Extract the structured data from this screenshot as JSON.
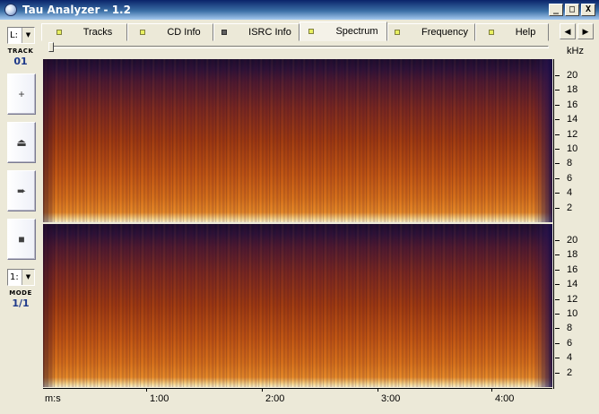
{
  "window": {
    "title": "Tau Analyzer - 1.2",
    "controls": {
      "minimize": "_",
      "maximize": "□",
      "close": "X"
    }
  },
  "sidebar": {
    "channel_combo": "L:",
    "track_label": "TRACK",
    "track_value": "01",
    "buttons": [
      {
        "name": "add",
        "glyph": "+"
      },
      {
        "name": "eject",
        "glyph": "⏏"
      },
      {
        "name": "play",
        "glyph": "➨"
      },
      {
        "name": "stop",
        "glyph": "■"
      }
    ],
    "mode_combo": "1:",
    "mode_label": "MODE",
    "mode_value": "1/1"
  },
  "tabs": [
    {
      "label": "Tracks",
      "led": "yellow",
      "active": false
    },
    {
      "label": "CD Info",
      "led": "yellow",
      "active": false
    },
    {
      "label": "ISRC Info",
      "led": "dark",
      "active": false
    },
    {
      "label": "Spectrum",
      "led": "yellow",
      "active": true
    },
    {
      "label": "Frequency",
      "led": "yellow",
      "active": false
    },
    {
      "label": "Help",
      "led": "yellow",
      "active": false
    }
  ],
  "tab_nav": {
    "prev": "◀",
    "next": "▶"
  },
  "frequency_scale": {
    "unit": "kHz",
    "ticks": [
      "20",
      "18",
      "16",
      "14",
      "12",
      "10",
      "8",
      "6",
      "4",
      "2"
    ]
  },
  "time_axis": {
    "unit_label": "m:s",
    "ticks": [
      "1:00",
      "2:00",
      "3:00",
      "4:00"
    ]
  }
}
